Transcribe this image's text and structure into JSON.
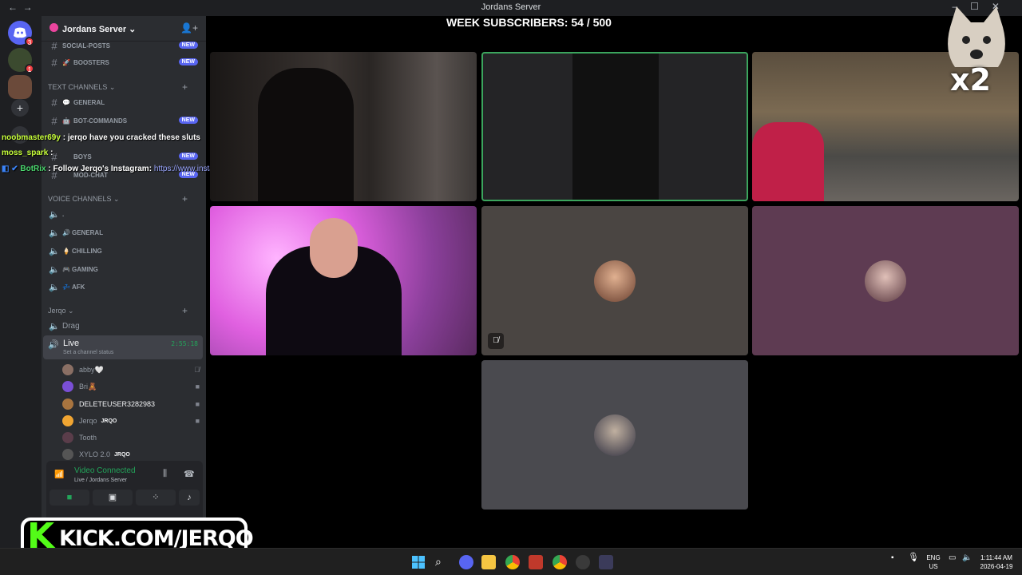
{
  "window": {
    "title": "Jordans Server"
  },
  "server": {
    "name": "Jordans Server ⌄"
  },
  "rail": {
    "badges": [
      "3",
      "1"
    ]
  },
  "channels_top": [
    {
      "name": "SOCIAL-POSTS",
      "emoji": "",
      "badge": "NEW"
    },
    {
      "name": "BOOSTERS",
      "emoji": "🚀",
      "badge": "NEW"
    }
  ],
  "text_category": "TEXT CHANNELS ⌄",
  "text_channels": [
    {
      "name": "GENERAL",
      "emoji": "💬",
      "badge": ""
    },
    {
      "name": "BOT-COMMANDS",
      "emoji": "🤖",
      "badge": "NEW"
    },
    {
      "name": "BOYS",
      "emoji": "",
      "badge": "NEW"
    },
    {
      "name": "MOD-CHAT",
      "emoji": "",
      "badge": "NEW"
    }
  ],
  "voice_category": "VOICE CHANNELS ⌄",
  "voice_channels": [
    {
      "name": ".",
      "emoji": ""
    },
    {
      "name": "GENERAL",
      "emoji": "🔊"
    },
    {
      "name": "CHILLING",
      "emoji": "🍦"
    },
    {
      "name": "GAMING",
      "emoji": "🎮"
    },
    {
      "name": "AFK",
      "emoji": "💤"
    }
  ],
  "jerqo_category": "Jerqo ⌄",
  "drag_channel": "Drag",
  "live_channel": {
    "name": "Live",
    "status": "Set a channel status",
    "timer": "2:55:18"
  },
  "voice_users": [
    {
      "name": "abby🤍",
      "tag": "",
      "status": "mic-off-icon",
      "color": "#8a6f64"
    },
    {
      "name": "Bri🧸",
      "tag": "",
      "status": "camera-icon",
      "color": "#7a4fd6"
    },
    {
      "name": "DELETEUSER3282983",
      "tag": "",
      "status": "camera-icon",
      "color": "#a8743f"
    },
    {
      "name": "Jerqo",
      "tag": "JRQO",
      "status": "camera-icon",
      "color": "#f0a532"
    },
    {
      "name": "Tooth",
      "tag": "",
      "status": "",
      "color": "#5a3d4a"
    },
    {
      "name": "XYLO 2.0",
      "tag": "JRQO",
      "status": "",
      "color": "#555"
    }
  ],
  "voice_panel": {
    "state": "Video Connected",
    "location": "Live / Jordans Server"
  },
  "chat_overlay": [
    {
      "user": "noobmaster69y",
      "sep": " : ",
      "text": "jerqo have you cracked these sluts"
    },
    {
      "user": "moss_spark",
      "sep": " : ",
      "text": ""
    },
    {
      "user": "BotRix",
      "sep": " : ",
      "text": "Follow Jerqo's Instagram: ",
      "link": "https://www.instagram.com/_jerqo"
    }
  ],
  "sub_counter": "WEEK SUBSCRIBERS: 54 / 500",
  "overlay_multiplier": "x2",
  "kick": {
    "k": "K",
    "text": "KICK.COM/JERQO"
  },
  "taskbar": {
    "lang": "ENG",
    "region": "US",
    "time": "1:11:44 AM",
    "date": "2026-04-19"
  }
}
